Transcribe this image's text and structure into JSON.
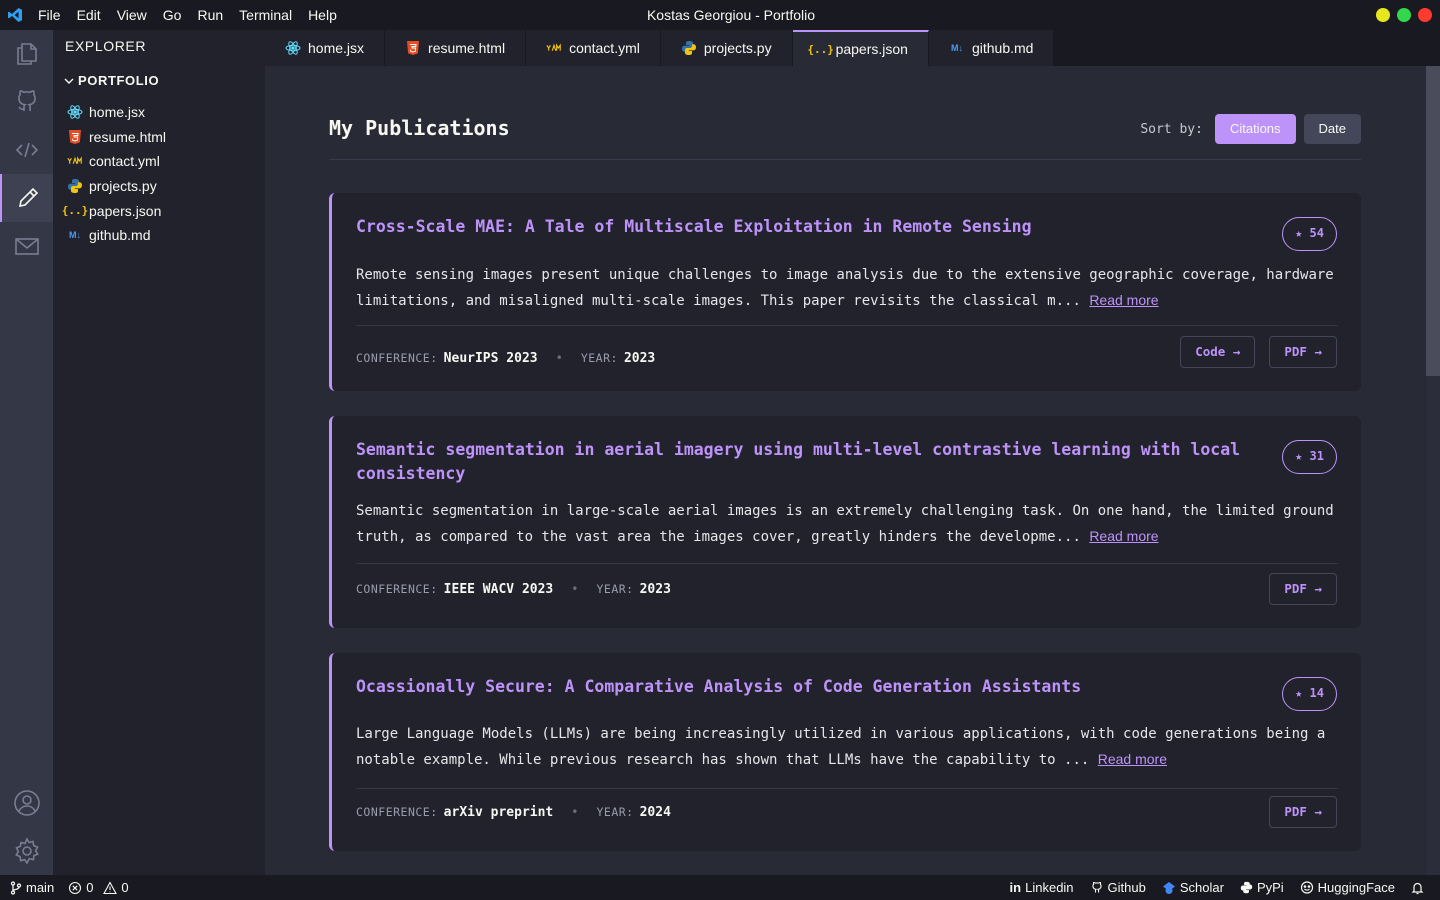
{
  "titlebar": {
    "menu": [
      "File",
      "Edit",
      "View",
      "Go",
      "Run",
      "Terminal",
      "Help"
    ],
    "window_title": "Kostas Georgiou - Portfolio",
    "traffic_colors": [
      "#e6e61c",
      "#32d74b",
      "#ff3b30"
    ]
  },
  "activity": [
    "files-icon",
    "github-icon",
    "code-icon",
    "pencil-icon",
    "mail-icon",
    "account-icon",
    "settings-icon"
  ],
  "sidebar": {
    "title": "EXPLORER",
    "folder": "PORTFOLIO",
    "files": [
      {
        "name": "home.jsx",
        "icon": "react-icon",
        "color": "#61dafb"
      },
      {
        "name": "resume.html",
        "icon": "html5-icon",
        "color": "#e44d26"
      },
      {
        "name": "contact.yml",
        "icon": "yaml-icon",
        "color": "#f1c40f"
      },
      {
        "name": "projects.py",
        "icon": "python-icon",
        "color": "#3572a5"
      },
      {
        "name": "papers.json",
        "icon": "json-icon",
        "color": "#f1c40f"
      },
      {
        "name": "github.md",
        "icon": "markdown-icon",
        "color": "#4a9cf0"
      }
    ]
  },
  "tabs": [
    {
      "label": "home.jsx",
      "active": false
    },
    {
      "label": "resume.html",
      "active": false
    },
    {
      "label": "contact.yml",
      "active": false
    },
    {
      "label": "projects.py",
      "active": false
    },
    {
      "label": "papers.json",
      "active": true
    },
    {
      "label": "github.md",
      "active": false
    }
  ],
  "main": {
    "title": "My Publications",
    "sort_label": "Sort by:",
    "sort_options": [
      {
        "label": "Citations",
        "active": true
      },
      {
        "label": "Date",
        "active": false
      }
    ],
    "papers": [
      {
        "title": "Cross-Scale MAE: A Tale of Multiscale Exploitation in Remote Sensing",
        "citations": "★ 54",
        "abstract": "Remote sensing images present unique challenges to image analysis due to the extensive geographic coverage, hardware limitations, and misaligned multi-scale images. This paper revisits the classical m...",
        "read_more": "Read more",
        "conference_label": "CONFERENCE:",
        "conference": "NeurIPS 2023",
        "year_label": "YEAR:",
        "year": "2023",
        "buttons": [
          "Code →",
          "PDF →"
        ]
      },
      {
        "title": "Semantic segmentation in aerial imagery using multi-level contrastive learning with local consistency",
        "citations": "★ 31",
        "abstract": "Semantic segmentation in large-scale aerial images is an extremely challenging task. On one hand, the limited ground truth, as compared to the vast area the images cover, greatly hinders the developme...",
        "read_more": "Read more",
        "conference_label": "CONFERENCE:",
        "conference": "IEEE WACV 2023",
        "year_label": "YEAR:",
        "year": "2023",
        "buttons": [
          "PDF →"
        ]
      },
      {
        "title": "Ocassionally Secure: A Comparative Analysis of Code Generation Assistants",
        "citations": "★ 14",
        "abstract": "Large Language Models (LLMs) are being increasingly utilized in various applications, with code generations being a notable example. While previous research has shown that LLMs have the capability to ...",
        "read_more": "Read more",
        "conference_label": "CONFERENCE:",
        "conference": "arXiv preprint",
        "year_label": "YEAR:",
        "year": "2024",
        "buttons": [
          "PDF →"
        ]
      }
    ]
  },
  "statusbar": {
    "branch": "main",
    "errors": "0",
    "warnings": "0",
    "links": [
      {
        "label": "Linkedin",
        "icon": "linkedin-icon"
      },
      {
        "label": "Github",
        "icon": "github-icon"
      },
      {
        "label": "Scholar",
        "icon": "scholar-icon"
      },
      {
        "label": "PyPi",
        "icon": "pypi-icon"
      },
      {
        "label": "HuggingFace",
        "icon": "huggingface-icon"
      }
    ]
  }
}
